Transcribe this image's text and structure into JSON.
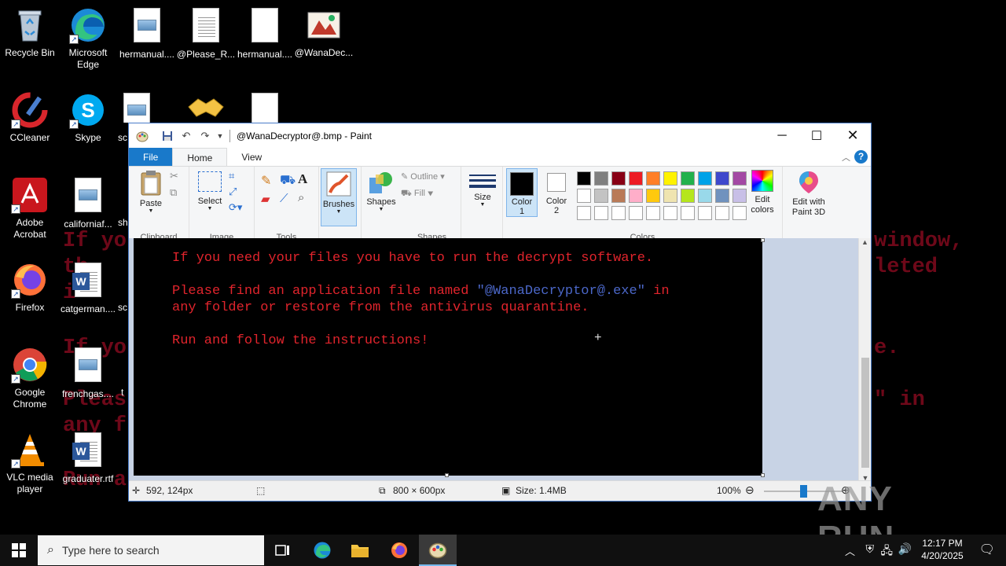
{
  "desktop": {
    "wallpaper_lines": [
      "If yo",
      "th",
      "i",
      "If yo",
      "Pleas",
      "any f",
      "Run a",
      "window,",
      "leted",
      "e.",
      "\" in"
    ],
    "icons": [
      {
        "label": "Recycle Bin"
      },
      {
        "label": "Microsoft Edge"
      },
      {
        "label": "hermanual...."
      },
      {
        "label": "@Please_R..."
      },
      {
        "label": "hermanual...."
      },
      {
        "label": "@WanaDec..."
      },
      {
        "label": "CCleaner"
      },
      {
        "label": "Skype"
      },
      {
        "label": "sc"
      },
      {
        "label": "Adobe Acrobat"
      },
      {
        "label": "californiaf..."
      },
      {
        "label": "sh"
      },
      {
        "label": "Firefox"
      },
      {
        "label": "catgerman...."
      },
      {
        "label": "sc"
      },
      {
        "label": "Google Chrome"
      },
      {
        "label": "frenchgas...."
      },
      {
        "label": "t"
      },
      {
        "label": "VLC media player"
      },
      {
        "label": "graduater.rtf"
      }
    ]
  },
  "paint": {
    "title": "@WanaDecryptor@.bmp - Paint",
    "tabs": {
      "file": "File",
      "home": "Home",
      "view": "View"
    },
    "ribbon": {
      "paste": "Paste",
      "clipboard": "Clipboard",
      "select": "Select",
      "image": "Image",
      "tools": "Tools",
      "brushes": "Brushes",
      "shapes": "Shapes",
      "outline": "Outline",
      "fill": "Fill",
      "shapes_group": "Shapes",
      "size": "Size",
      "color1": "Color",
      "color1_num": "1",
      "color2": "Color",
      "color2_num": "2",
      "edit_colors": "Edit colors",
      "edit_paint3d": "Edit with Paint 3D",
      "colors": "Colors",
      "color1_value": "#000000",
      "color2_value": "#ffffff",
      "palette_row1": [
        "#000000",
        "#7f7f7f",
        "#880015",
        "#ed1c24",
        "#ff7f27",
        "#fff200",
        "#22b14c",
        "#00a2e8",
        "#3f48cc",
        "#a349a4"
      ],
      "palette_row2": [
        "#ffffff",
        "#c3c3c3",
        "#b97a57",
        "#ffaec9",
        "#ffc90e",
        "#efe4b0",
        "#b5e61d",
        "#99d9ea",
        "#7092be",
        "#c8bfe7"
      ]
    },
    "canvas_text": {
      "line1": "If you need your files you have to run the decrypt software.",
      "line2a": "Please find an application file named ",
      "line2b": "\"@WanaDecryptor@.exe\"",
      "line2c": " in",
      "line3": "any folder or restore from the antivirus quarantine.",
      "line4": "Run and follow the instructions!"
    },
    "status": {
      "cursor_pos": "592, 124px",
      "image_size": "800 × 600px",
      "file_size": "Size: 1.4MB",
      "zoom": "100%",
      "zoom_fraction": 0.5
    }
  },
  "taskbar": {
    "search_placeholder": "Type here to search",
    "time": "12:17 PM",
    "date": "4/20/2025"
  },
  "watermark": "ANY RUN"
}
